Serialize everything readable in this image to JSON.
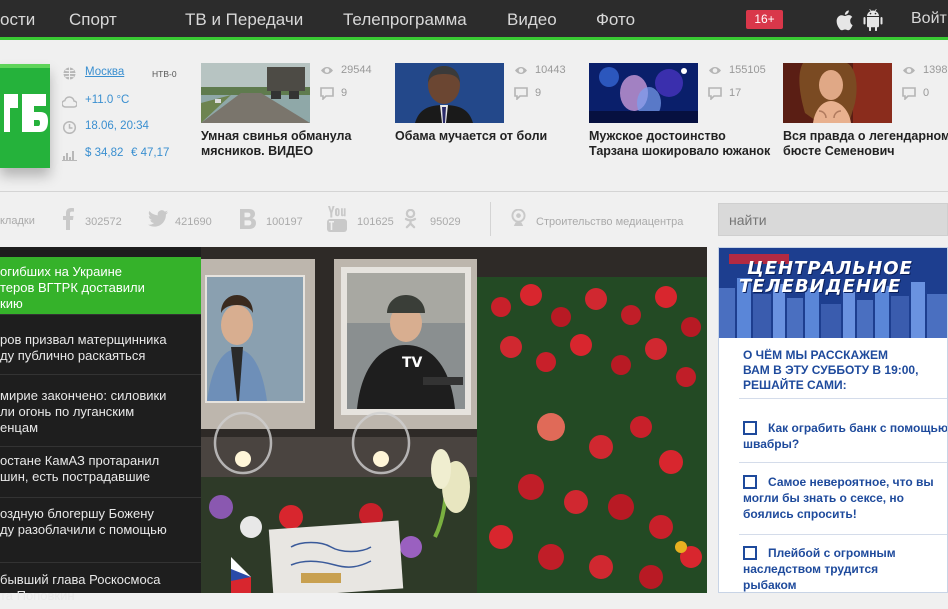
{
  "nav": {
    "items": [
      "ости",
      "Спорт",
      "ТВ и Передачи",
      "Телепрограмма",
      "Видео",
      "Фото"
    ],
    "age_badge": "16+",
    "login": "Войт"
  },
  "info": {
    "city": "Москва",
    "channel": "НТВ-0",
    "temperature": "+11.0 °С",
    "datetime": "18.06, 20:34",
    "usd": "$ 34,82",
    "eur": "€ 47,17"
  },
  "top_stories": [
    {
      "caption": "Умная свинья обманула\nмясников. ВИДЕО",
      "views": "29544",
      "comments": "9"
    },
    {
      "caption": "Обама мучается от боли",
      "views": "10443",
      "comments": "9"
    },
    {
      "caption": "Мужское достоинство\nТарзана шокировало южанок",
      "views": "155105",
      "comments": "17"
    },
    {
      "caption": "Вся правда о легендарном\nбюсте Семенович",
      "views": "1398",
      "comments": "0"
    }
  ],
  "social": {
    "bookmarks_label": "кладки",
    "facebook": "302572",
    "twitter": "421690",
    "vk": "100197",
    "youtube": "101625",
    "odnoklassniki": "95029",
    "media_center": "Строительство медиацентра"
  },
  "search": {
    "placeholder": "найти"
  },
  "news_list": [
    "огибших на Украине\nтеров ВГТРК доставили\nкию",
    "ров призвал матерщинника\nду публично раскаяться",
    "мирие закончено: силовики\nли огонь по луганским\nенцам",
    "остане КамАЗ протаранил\nшин, есть пострадавшие",
    "оздную блогершу Божену\nду разоблачили с помощью",
    "бывший глава Роскосмоса\nта Поповкин"
  ],
  "promo": {
    "logo_line1": "ЦЕНТРАЛЬНОЕ",
    "logo_line2": "ТЕЛЕВИДЕНИЕ",
    "question": "О ЧЁМ МЫ РАССКАЖЕМ\nВАМ В ЭТУ СУББОТУ В 19:00,\nРЕШАЙТЕ САМИ:",
    "options": [
      "Как ограбить банк с помощью\nшвабры?",
      "Самое невероятное, что вы\nмогли бы знать о сексе, но\nбоялись спросить!",
      "Плейбой с огромным\nнаследством трудится\nрыбаком"
    ]
  },
  "colors": {
    "accent": "#39c933",
    "nav_bg": "#2c2c2c",
    "promo_blue": "#1e4a9c",
    "badge": "#d9374a"
  }
}
